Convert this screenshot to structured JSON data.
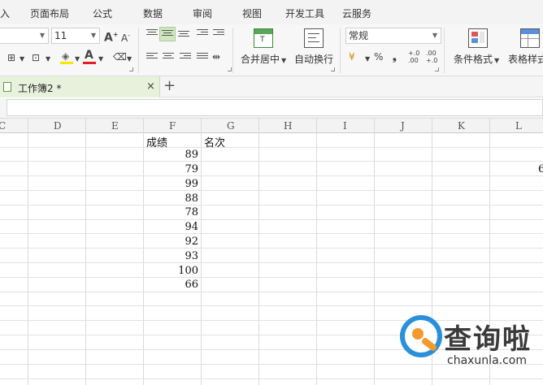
{
  "menu": {
    "insert": "入",
    "page_layout": "页面布局",
    "formulas": "公式",
    "data": "数据",
    "review": "审阅",
    "view": "视图",
    "developer": "开发工具",
    "cloud": "云服务"
  },
  "ribbon": {
    "font_size": "11",
    "number_format": "常规",
    "merge_center": "合并居中",
    "wrap_text": "自动换行",
    "cond_format": "条件格式",
    "table_style": "表格样式",
    "percent": "%",
    "comma": "❟",
    "inc_decimal": "+.0\n.00",
    "dec_decimal": ".00\n+.0"
  },
  "tab": {
    "label": "工作簿2 *",
    "close": "×",
    "new": "+"
  },
  "columns": [
    "C",
    "D",
    "E",
    "F",
    "G",
    "H",
    "I",
    "J",
    "K",
    "L"
  ],
  "sheet": {
    "header_f": "成绩",
    "header_g": "名次",
    "scores": [
      "89",
      "79",
      "99",
      "88",
      "78",
      "94",
      "92",
      "93",
      "100",
      "66"
    ],
    "clipped_l": "6"
  },
  "watermark": {
    "brand": "查询啦",
    "url": "chaxunla.com",
    "blue": "#2b8fd9",
    "orange": "#f29a2e"
  }
}
